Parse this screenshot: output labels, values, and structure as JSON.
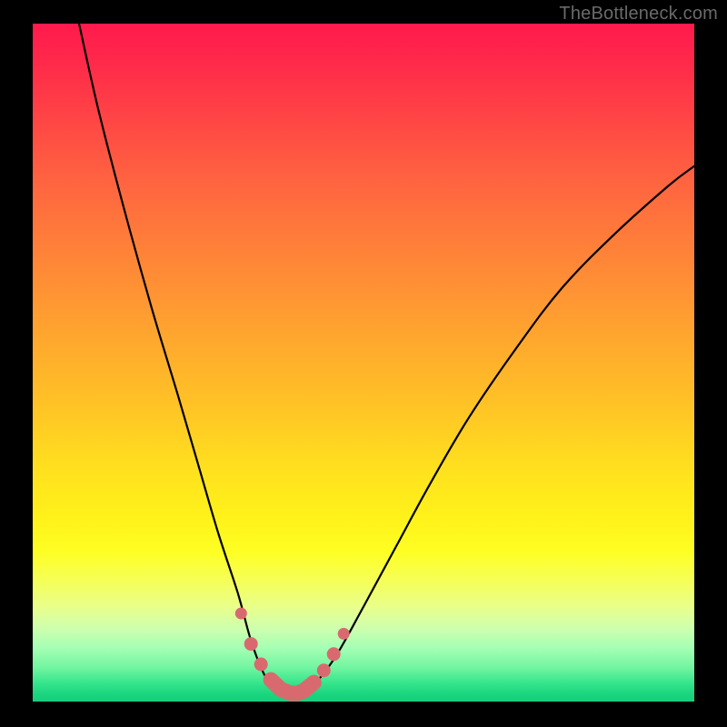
{
  "watermark": "TheBottleneck.com",
  "colors": {
    "frame": "#000000",
    "curve": "#000000",
    "dots": "#d86a6f",
    "gradient_top": "#ff1a4d",
    "gradient_bottom": "#17cf7b"
  },
  "chart_data": {
    "type": "line",
    "title": "",
    "xlabel": "",
    "ylabel": "",
    "xlim": [
      0,
      100
    ],
    "ylim": [
      0,
      100
    ],
    "note": "Values read from plotted curve relative to plot area; (0,0)=bottom-left, (100,100)=top-left. Curve depicts bottleneck severity vs. x; minimum near x≈36–41.",
    "series": [
      {
        "name": "bottleneck-curve",
        "x": [
          7,
          10,
          14,
          18,
          22,
          25,
          28,
          31,
          33,
          35,
          37,
          39,
          41,
          43,
          46,
          50,
          55,
          60,
          66,
          73,
          80,
          88,
          96,
          100
        ],
        "y": [
          100,
          87,
          72,
          58,
          45,
          35,
          25,
          16,
          9,
          4,
          1.5,
          1,
          1.5,
          3,
          7,
          14,
          23,
          32,
          42,
          52,
          61,
          69,
          76,
          79
        ]
      }
    ],
    "markers": {
      "name": "highlighted-points",
      "x": [
        31.5,
        33,
        34.5,
        36,
        37.5,
        39,
        40,
        41,
        42.5,
        44,
        45.5,
        47
      ],
      "y": [
        13,
        8.5,
        5.5,
        3.2,
        1.8,
        1.2,
        1.2,
        1.6,
        2.8,
        4.6,
        7,
        10
      ]
    }
  }
}
